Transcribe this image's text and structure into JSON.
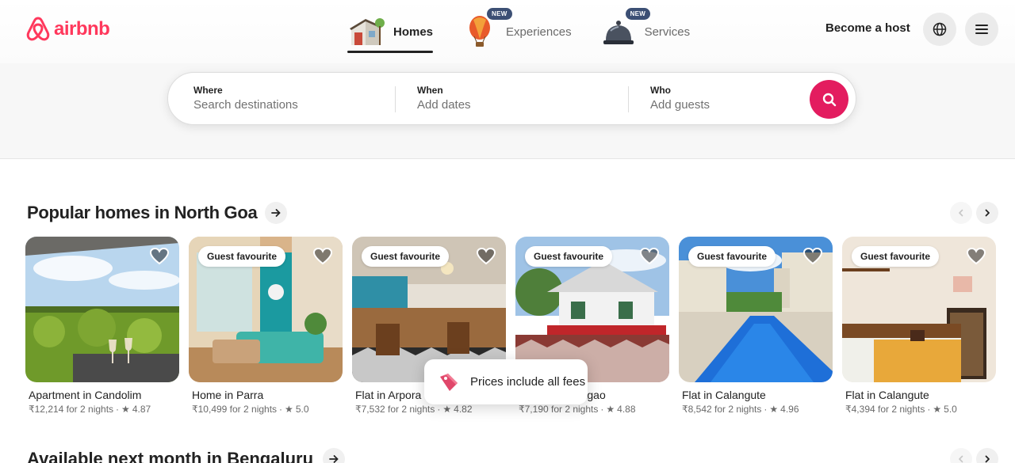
{
  "brand": {
    "name": "airbnb",
    "color": "#ff385c"
  },
  "nav": {
    "tabs": [
      {
        "label": "Homes",
        "icon": "house-icon",
        "active": true,
        "badge": ""
      },
      {
        "label": "Experiences",
        "icon": "hot-air-balloon-icon",
        "active": false,
        "badge": "NEW"
      },
      {
        "label": "Services",
        "icon": "service-bell-icon",
        "active": false,
        "badge": "NEW"
      }
    ]
  },
  "header": {
    "host_label": "Become a host",
    "globe_icon": "globe-icon",
    "menu_icon": "hamburger-menu-icon"
  },
  "search": {
    "where_label": "Where",
    "where_placeholder": "Search destinations",
    "when_label": "When",
    "when_placeholder": "Add dates",
    "who_label": "Who",
    "who_placeholder": "Add guests",
    "button_icon": "search-icon",
    "button_color": "#e31c5f"
  },
  "section": {
    "title": "Popular homes in North Goa",
    "cards": [
      {
        "title": "Apartment in Candolim",
        "price": "₹12,214 for 2 nights",
        "rating": "4.87",
        "badge": ""
      },
      {
        "title": "Home in Parra",
        "price": "₹10,499 for 2 nights",
        "rating": "5.0",
        "badge": "Guest favourite"
      },
      {
        "title": "Flat in Arpora",
        "price": "₹7,532 for 2 nights",
        "rating": "4.82",
        "badge": "Guest favourite"
      },
      {
        "title": "Home in Assagao",
        "price": "₹7,190 for 2 nights",
        "rating": "4.88",
        "badge": "Guest favourite"
      },
      {
        "title": "Flat in Calangute",
        "price": "₹8,542 for 2 nights",
        "rating": "4.96",
        "badge": "Guest favourite"
      },
      {
        "title": "Flat in Calangute",
        "price": "₹4,394 for 2 nights",
        "rating": "5.0",
        "badge": "Guest favourite"
      }
    ]
  },
  "toast": {
    "text": "Prices include all fees",
    "icon": "price-tag-icon"
  },
  "section2": {
    "title": "Available next month in Bengaluru"
  },
  "separators": {
    "dot": "·",
    "star": "★"
  }
}
